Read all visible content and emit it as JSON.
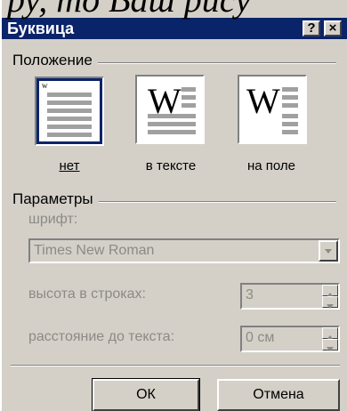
{
  "background_text": "ру, то Ваш рису",
  "dialog": {
    "title": "Буквица",
    "help_button": "?",
    "close_button": "×"
  },
  "position_group": {
    "label": "Положение",
    "options": [
      {
        "label": "нет",
        "selected": true
      },
      {
        "label": "в тексте",
        "selected": false,
        "glyph": "W"
      },
      {
        "label": "на поле",
        "selected": false,
        "glyph": "W"
      }
    ],
    "none_small_glyph": "w"
  },
  "params_group": {
    "label": "Параметры",
    "font_label": "шрифт:",
    "font_value": "Times New Roman",
    "height_label": "высота в строках:",
    "height_value": "3",
    "distance_label": "расстояние до текста:",
    "distance_value": "0 см"
  },
  "buttons": {
    "ok": "ОК",
    "cancel": "Отмена"
  },
  "colors": {
    "titlebar": "#0a246a",
    "face": "#d4d0c8",
    "disabled_text": "#8c8a85"
  }
}
